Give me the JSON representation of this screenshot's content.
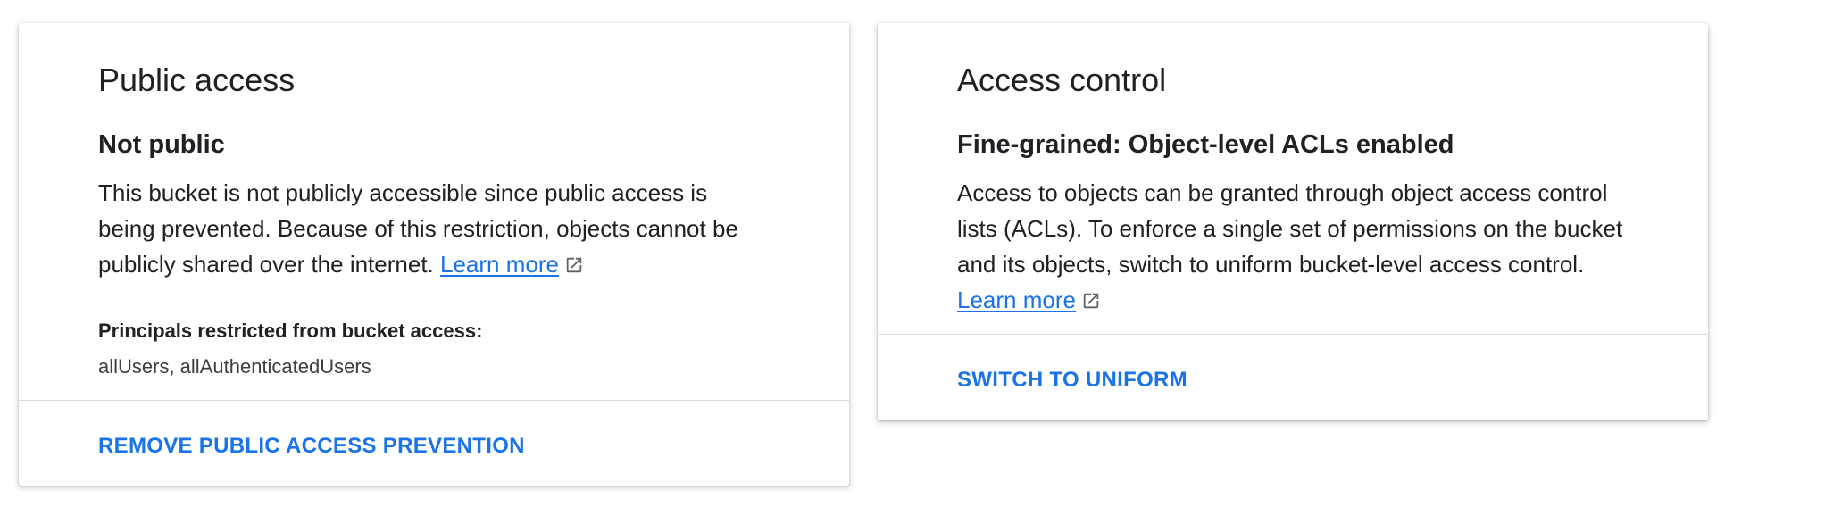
{
  "public_access": {
    "title": "Public access",
    "status": "Not public",
    "description": "This bucket is not publicly accessible since public access is being prevented. Because of this restriction, objects cannot be publicly shared over the internet.",
    "learn_more": "Learn more",
    "principals_label": "Principals restricted from bucket access:",
    "principals_value": "allUsers, allAuthenticatedUsers",
    "action_label": "REMOVE PUBLIC ACCESS PREVENTION"
  },
  "access_control": {
    "title": "Access control",
    "status": "Fine-grained: Object-level ACLs enabled",
    "description": "Access to objects can be granted through object access control lists (ACLs). To enforce a single set of permissions on the bucket and its objects, switch to uniform bucket-level access control.",
    "learn_more": "Learn more",
    "action_label": "SWITCH TO UNIFORM"
  },
  "icons": {
    "external_link": "open-in-new-icon"
  },
  "colors": {
    "link": "#1a73e8",
    "text": "#202124",
    "divider": "#dadce0"
  }
}
